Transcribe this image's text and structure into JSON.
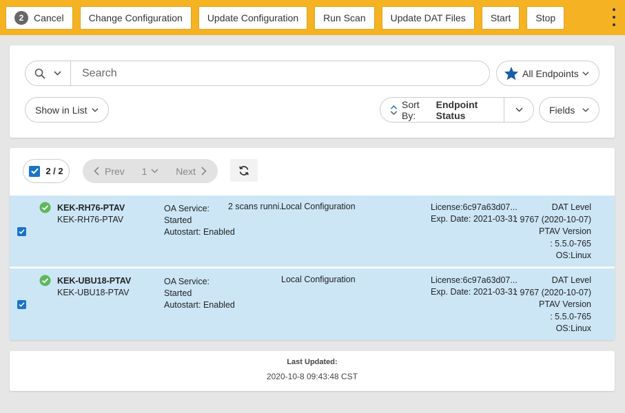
{
  "toolbar": {
    "badge_count": "2",
    "cancel_label": "Cancel",
    "change_config_label": "Change Configuration",
    "update_config_label": "Update Configuration",
    "run_scan_label": "Run Scan",
    "update_dat_label": "Update DAT Files",
    "start_label": "Start",
    "stop_label": "Stop",
    "accent": "#f5b323"
  },
  "search": {
    "placeholder": "Search",
    "endpoints_label": "All Endpoints",
    "show_in_list_label": "Show in List",
    "sort_prefix": "Sort By:",
    "sort_value": "Endpoint Status",
    "fields_label": "Fields"
  },
  "list": {
    "selection_count": "2 / 2",
    "prev_label": "Prev",
    "page_number": "1",
    "next_label": "Next",
    "rows": [
      {
        "name": "KEK-RH76-PTAV",
        "subname": "KEK-RH76-PTAV",
        "oa_line1": "OA Service:",
        "oa_line2": "Started",
        "oa_line3": "Autostart: Enabled",
        "scans": "2 scans runni...",
        "config": "Local Configuration",
        "license": "License:6c97a63d07...",
        "exp_date": "Exp. Date: 2021-03-31",
        "dat_label": "DAT Level",
        "dat_value": ": 9767 (2020-10-07)",
        "ptav_label": "PTAV Version",
        "ptav_value": ": 5.5.0-765",
        "os": "OS:Linux"
      },
      {
        "name": "KEK-UBU18-PTAV",
        "subname": "KEK-UBU18-PTAV",
        "oa_line1": "OA Service:",
        "oa_line2": "Started",
        "oa_line3": "Autostart: Enabled",
        "scans": "",
        "config": "Local Configuration",
        "license": "License:6c97a63d07...",
        "exp_date": "Exp. Date: 2021-03-31",
        "dat_label": "DAT Level",
        "dat_value": ": 9767 (2020-10-07)",
        "ptav_label": "PTAV Version",
        "ptav_value": ": 5.5.0-765",
        "os": "OS:Linux"
      }
    ],
    "row_color": "#cce6f6",
    "status_color": "#5cb85c"
  },
  "footer": {
    "label": "Last Updated:",
    "timestamp": "2020-10-8 09:43:48 CST"
  },
  "icons": [
    "search-icon",
    "chevron-down-icon",
    "star-icon",
    "sort-icon",
    "refresh-icon",
    "check-circle-icon",
    "checkbox-icon",
    "kebab-menu-icon"
  ]
}
